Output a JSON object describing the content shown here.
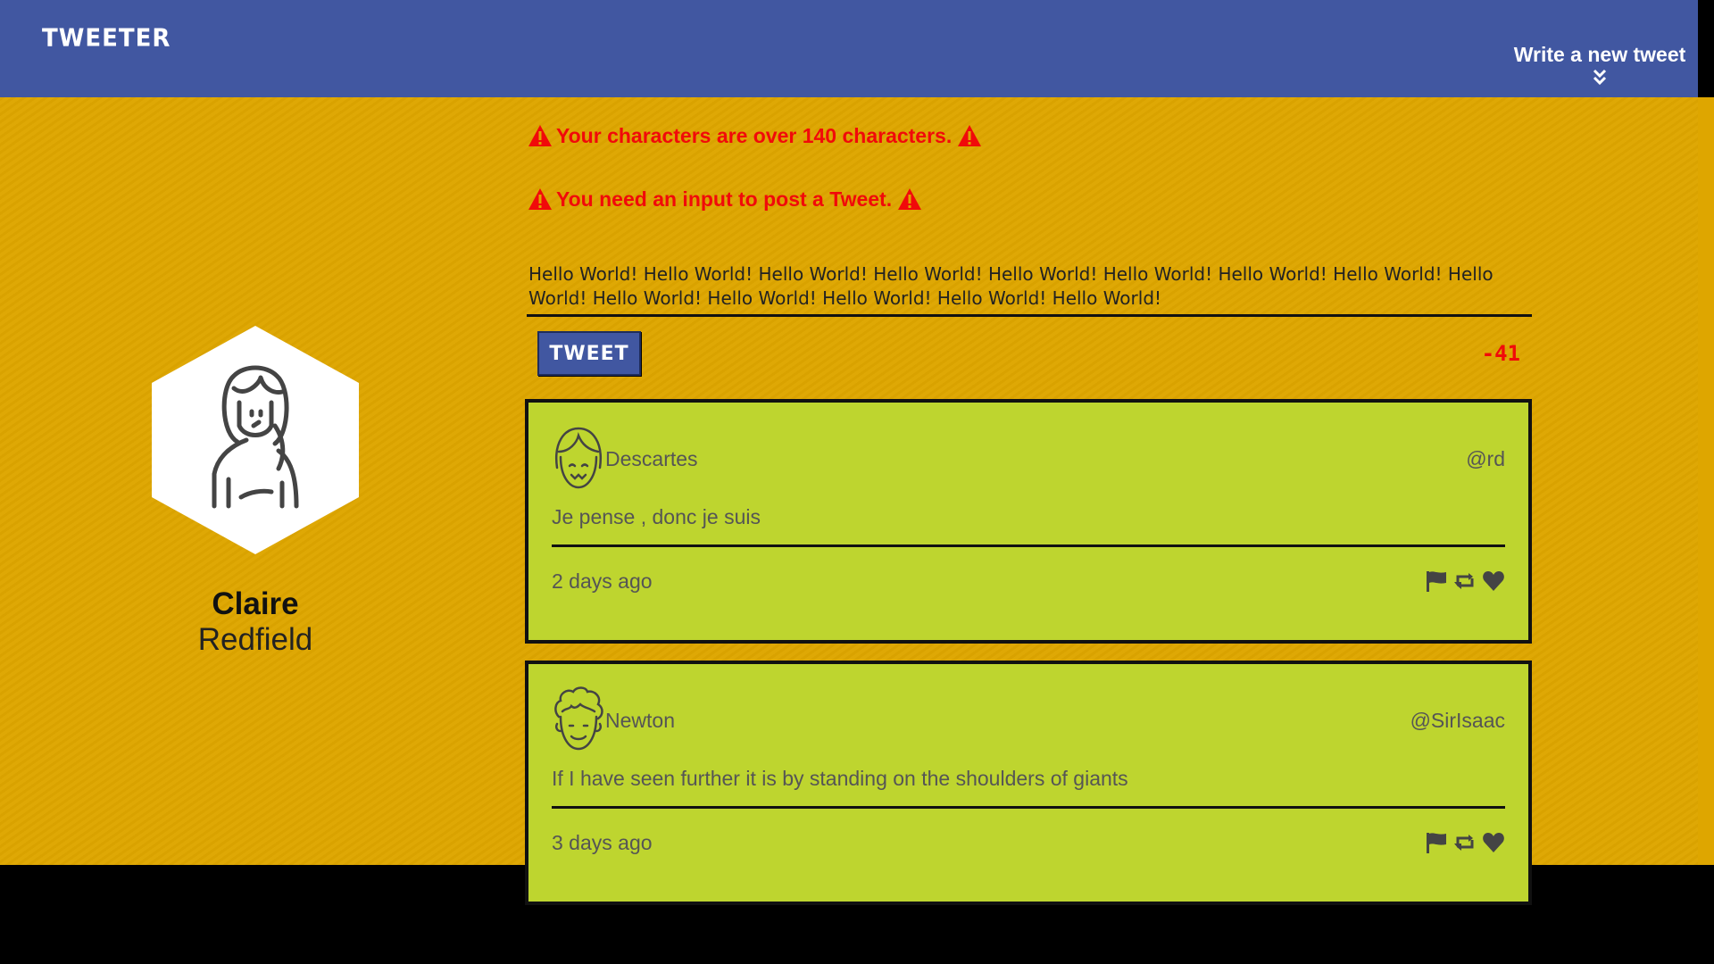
{
  "header": {
    "logo": "TWEETER",
    "compose_toggle_label": "Write a new tweet",
    "compose_toggle_icon": "double-chevron-down-icon"
  },
  "profile": {
    "first_name": "Claire",
    "last_name": "Redfield",
    "avatar_icon": "woman-avatar-icon"
  },
  "errors": [
    {
      "text": "Your characters are over 140 characters.",
      "icon": "warning-icon"
    },
    {
      "text": "You need an input to post a Tweet.",
      "icon": "warning-icon"
    }
  ],
  "composer": {
    "text": "Hello World! Hello World! Hello World! Hello World! Hello World! Hello World! Hello World! Hello World! Hello World! Hello World! Hello World! Hello World! Hello World! Hello World!",
    "button_label": "TWEET",
    "counter": "-41"
  },
  "tweets": [
    {
      "user": "Descartes",
      "handle": "@rd",
      "content": "Je pense , donc je suis",
      "time": "2 days ago",
      "avatar_icon": "girl-avatar-icon"
    },
    {
      "user": "Newton",
      "handle": "@SirIsaac",
      "content": "If I have seen further it is by standing on the shoulders of giants",
      "time": "3 days ago",
      "avatar_icon": "curly-hair-avatar-icon"
    }
  ],
  "actions": [
    "flag-icon",
    "retweet-icon",
    "heart-icon"
  ],
  "colors": {
    "header": "#4157a1",
    "background": "#dea600",
    "tweet_card": "#bed52f",
    "error": "#f10a0a"
  }
}
